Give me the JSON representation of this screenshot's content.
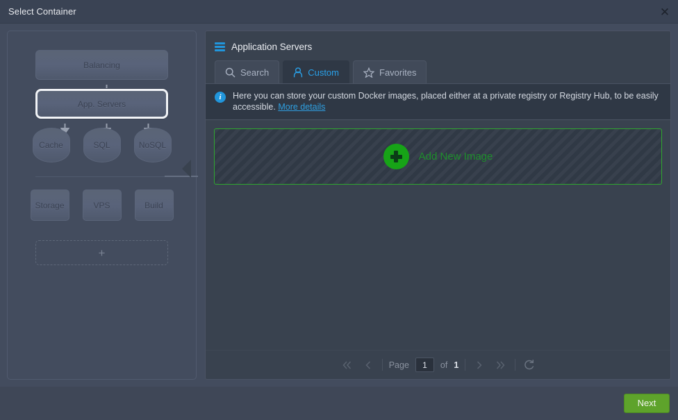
{
  "window": {
    "title": "Select Container",
    "close_label": "✕"
  },
  "topology": {
    "nodes": {
      "balancing": "Balancing",
      "app_servers": "App. Servers",
      "cache": "Cache",
      "sql": "SQL",
      "nosql": "NoSQL",
      "storage": "Storage",
      "vps": "VPS",
      "build": "Build"
    },
    "add_node_label": "+",
    "selected": "App. Servers"
  },
  "content": {
    "title": "Application Servers",
    "icon": "layers-icon",
    "tabs": [
      {
        "label": "Search",
        "icon": "search-icon",
        "active": false
      },
      {
        "label": "Custom",
        "icon": "user-icon",
        "active": true
      },
      {
        "label": "Favorites",
        "icon": "star-icon",
        "active": false
      }
    ],
    "info": {
      "text": "Here you can store your custom Docker images, placed either at a private registry or Registry Hub, to be easily accessible.",
      "link_label": "More details",
      "icon": "info-icon"
    },
    "add_image": {
      "label": "Add New Image",
      "icon": "plus-circle-icon",
      "accent_color": "#2fa82f"
    },
    "pager": {
      "first_icon": "double-chevron-left-icon",
      "prev_icon": "chevron-left-icon",
      "page_label": "Page",
      "page_value": "1",
      "of_label": "of",
      "total_pages": "1",
      "next_icon": "chevron-right-icon",
      "last_icon": "double-chevron-right-icon",
      "refresh_icon": "refresh-icon"
    }
  },
  "footer": {
    "next_label": "Next",
    "next_color": "#5ea32b"
  }
}
